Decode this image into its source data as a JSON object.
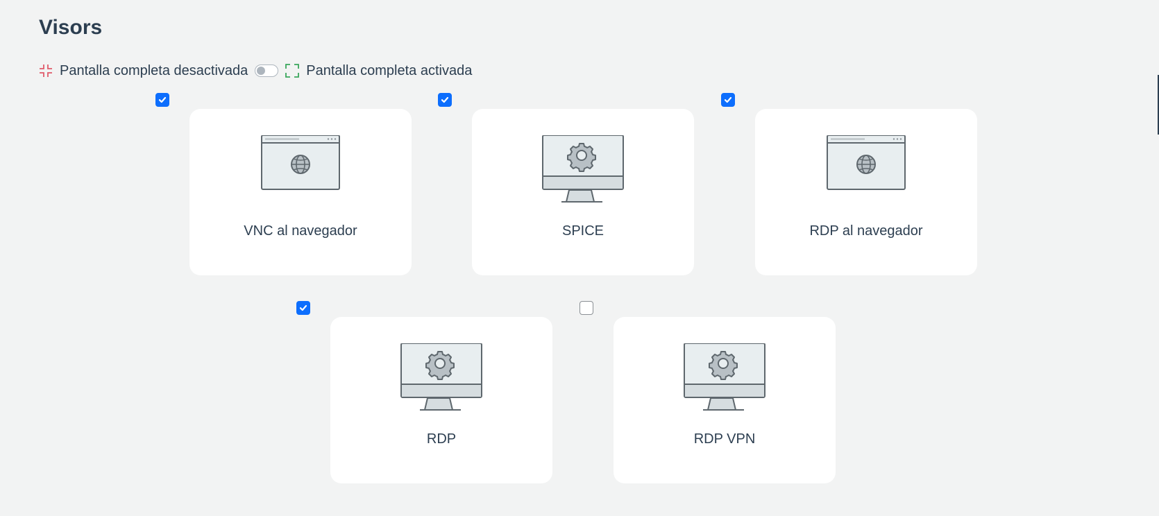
{
  "page": {
    "title": "Visors"
  },
  "fullscreen": {
    "off_label": "Pantalla completa desactivada",
    "on_label": "Pantalla completa activada",
    "toggle_on": false,
    "off_icon_color": "#e05a6a",
    "on_icon_color": "#3aa65b"
  },
  "viewers": [
    {
      "label": "VNC al navegador",
      "icon": "browser-globe-icon",
      "checked": true
    },
    {
      "label": "SPICE",
      "icon": "monitor-gear-icon",
      "checked": true
    },
    {
      "label": "RDP al navegador",
      "icon": "browser-globe-icon",
      "checked": true
    },
    {
      "label": "RDP",
      "icon": "monitor-gear-icon",
      "checked": true
    },
    {
      "label": "RDP VPN",
      "icon": "monitor-gear-icon",
      "checked": false
    }
  ],
  "colors": {
    "accent": "#0d6efd",
    "background": "#f2f3f3",
    "card": "#ffffff",
    "text": "#2c3e50"
  }
}
